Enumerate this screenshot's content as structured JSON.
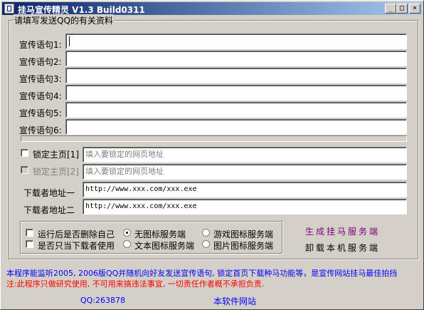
{
  "window": {
    "title": "挂马宣传精灵 V1.3  Build0311",
    "controls": {
      "minimize": "_",
      "maximize": "□",
      "close": "×"
    }
  },
  "group": {
    "label": "请填写发送QQ的有关资料"
  },
  "slogans": [
    {
      "label": "宣传语句1:",
      "value": ""
    },
    {
      "label": "宣传语句2:",
      "value": ""
    },
    {
      "label": "宣传语句3:",
      "value": ""
    },
    {
      "label": "宣传语句4:",
      "value": ""
    },
    {
      "label": "宣传语句5:",
      "value": ""
    },
    {
      "label": "宣传语句6:",
      "value": ""
    }
  ],
  "homepage": [
    {
      "label": "锁定主页[1]",
      "placeholder": "填入要锁定的网页地址",
      "enabled": true
    },
    {
      "label": "锁定主页[2]",
      "placeholder": "填入要锁定的网页地址",
      "enabled": false
    }
  ],
  "downloader": [
    {
      "label": "下载者地址一",
      "value": "http://www.xxx.com/xxx.exe"
    },
    {
      "label": "下载者地址二",
      "value": "http://www.xxx.com/xxx.exe"
    }
  ],
  "options": {
    "delete_after_run": "运行后是否删除自己",
    "downloader_only": "是否只当下载者使用",
    "radios": [
      {
        "label": "无图标服务端",
        "selected": true
      },
      {
        "label": "游戏图标服务端",
        "selected": false
      },
      {
        "label": "文本图标服务端",
        "selected": false
      },
      {
        "label": "图片图标服务端",
        "selected": false
      }
    ]
  },
  "actions": {
    "generate": "生成挂马服务端",
    "uninstall": "卸载本机服务端"
  },
  "notes": {
    "line1": "本程序能监听2005, 2006版QQ并随机向好友发送宣传语句, 锁定首页下载种马功能等，是宣传网站挂马最佳拍挡",
    "line2": "注:此程序只做研究使用, 不可用来搞违法事宜, 一切责任作者概不承担负责."
  },
  "footer": {
    "qq": "QQ:263878",
    "site": "本软件网站"
  },
  "colors": {
    "title_start": "#0a246a",
    "title_end": "#a6caf0",
    "generate": "#800080",
    "note_blue": "#0000ff",
    "note_red": "#ff0000"
  }
}
